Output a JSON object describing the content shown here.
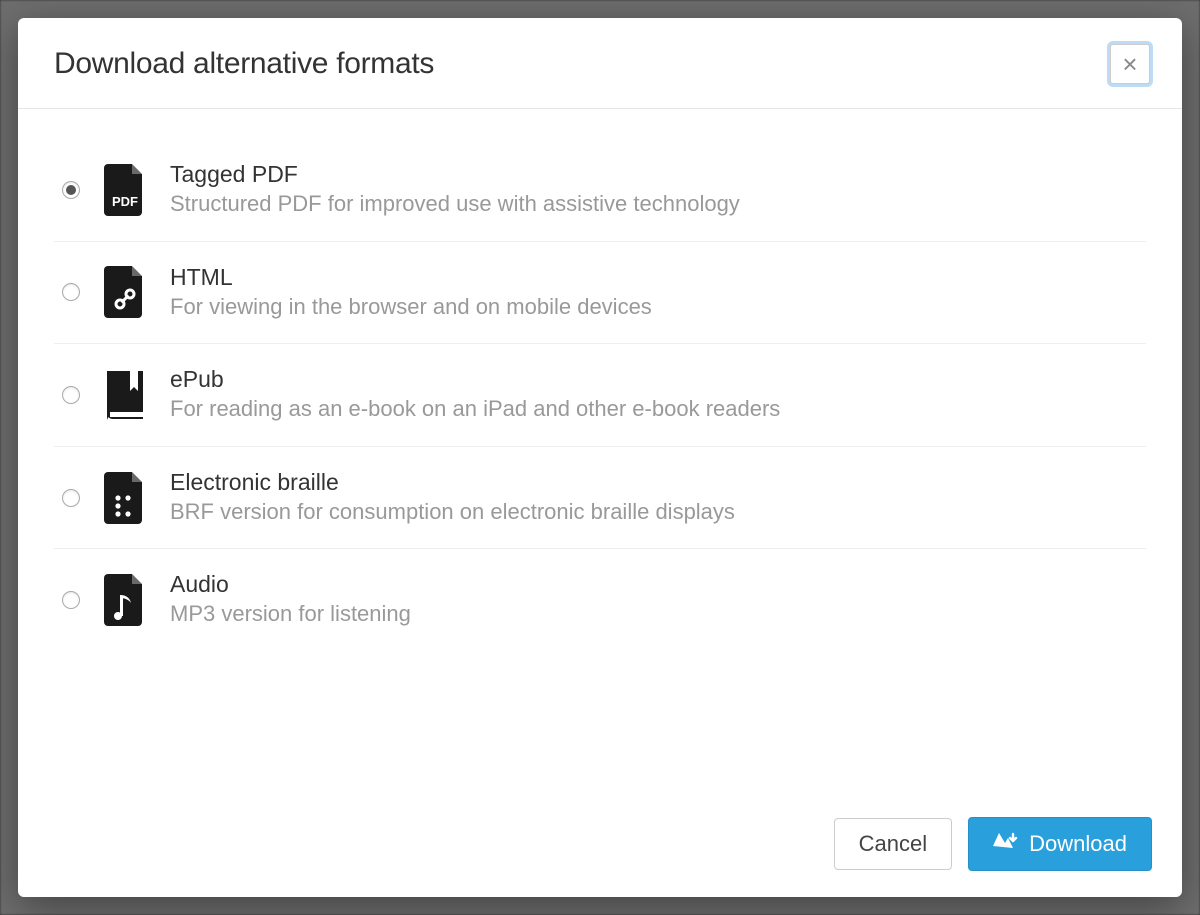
{
  "modal": {
    "title": "Download alternative formats",
    "close_label": "×"
  },
  "formats": [
    {
      "id": "tagged-pdf",
      "title": "Tagged PDF",
      "desc": "Structured PDF for improved use with assistive technology",
      "selected": true,
      "icon": "pdf"
    },
    {
      "id": "html",
      "title": "HTML",
      "desc": "For viewing in the browser and on mobile devices",
      "selected": false,
      "icon": "link"
    },
    {
      "id": "epub",
      "title": "ePub",
      "desc": "For reading as an e-book on an iPad and other e-book readers",
      "selected": false,
      "icon": "book"
    },
    {
      "id": "braille",
      "title": "Electronic braille",
      "desc": "BRF version for consumption on electronic braille displays",
      "selected": false,
      "icon": "braille"
    },
    {
      "id": "audio",
      "title": "Audio",
      "desc": "MP3 version for listening",
      "selected": false,
      "icon": "audio"
    }
  ],
  "footer": {
    "cancel_label": "Cancel",
    "download_label": "Download"
  }
}
